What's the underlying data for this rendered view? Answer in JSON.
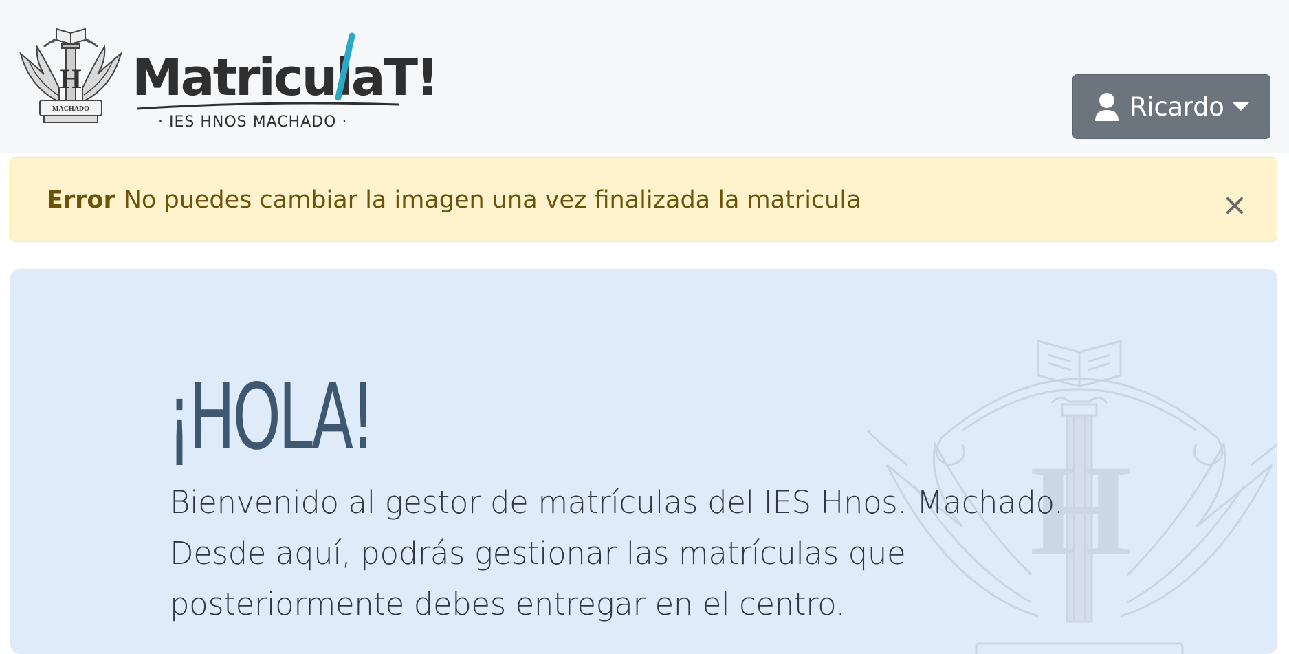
{
  "header": {
    "logo_name": "MatriculaT!",
    "logo_subtitle": "· IES HNOS  MACHADO ·",
    "crest_label": "MACHADO",
    "crest_icon": "school-crest-icon",
    "brand_accent": "#2aa9c4"
  },
  "user_menu": {
    "icon": "user-icon",
    "name": "Ricardo",
    "background": "#6c757d"
  },
  "alert": {
    "type": "warning",
    "title": "Error",
    "message": "No puedes cambiar la imagen una vez finalizada la matricula",
    "close_icon": "close-icon",
    "background": "#fff3cd",
    "text_color": "#664d03"
  },
  "hero": {
    "title": "¡HOLA!",
    "text": "Bienvenido al gestor de matrículas del IES Hnos. Machado. Desde aquí, podrás gestionar las matrículas que posteriormente debes entregar en el centro.",
    "background": "#dfebf8",
    "watermark_icon": "school-crest-watermark-icon"
  }
}
